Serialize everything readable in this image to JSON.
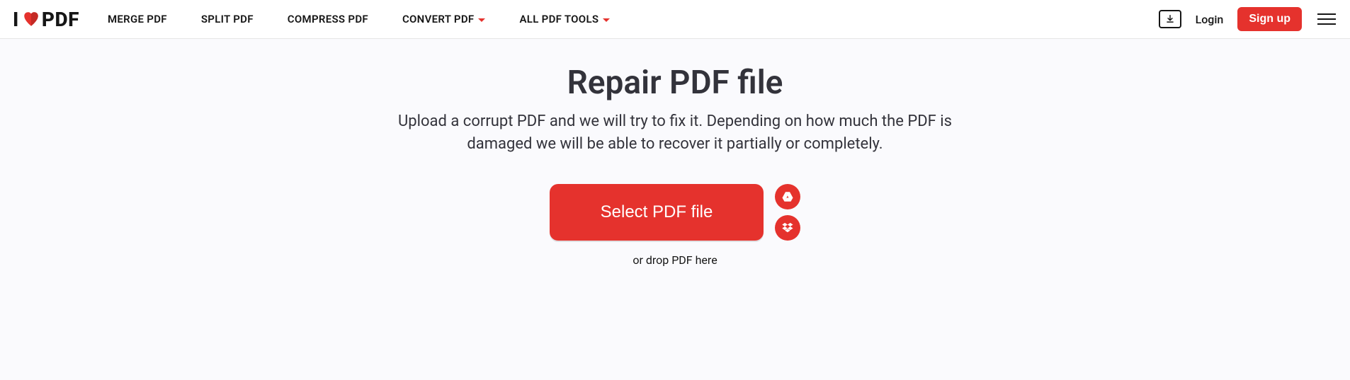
{
  "logo": {
    "text_prefix": "I",
    "text_suffix": "PDF"
  },
  "nav": {
    "merge": "MERGE PDF",
    "split": "SPLIT PDF",
    "compress": "COMPRESS PDF",
    "convert": "CONVERT PDF",
    "all_tools": "ALL PDF TOOLS"
  },
  "auth": {
    "login": "Login",
    "signup": "Sign up"
  },
  "page": {
    "title": "Repair PDF file",
    "subtitle": "Upload a corrupt PDF and we will try to fix it. Depending on how much the PDF is damaged we will be able to recover it partially or completely.",
    "select_button": "Select PDF file",
    "drop_hint": "or drop PDF here"
  },
  "colors": {
    "accent": "#e5322d"
  }
}
